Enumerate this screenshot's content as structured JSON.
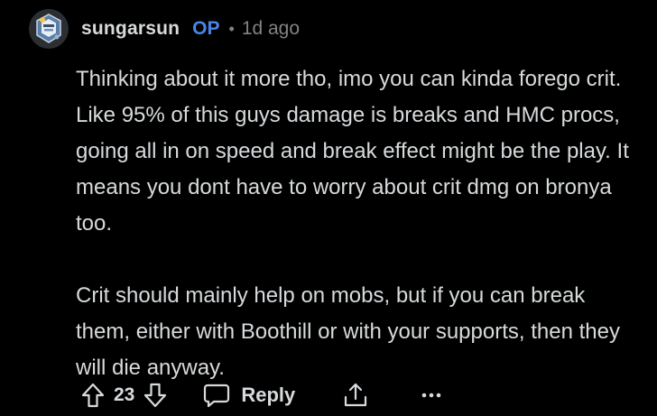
{
  "comment": {
    "author": "sungarsun",
    "op_badge": "OP",
    "separator": "•",
    "timestamp": "1d ago",
    "paragraphs": [
      "Thinking about it more tho, imo you can kinda forego crit. Like 95% of this guys damage is breaks and HMC procs, going all in on speed and break effect might be the play. It means you dont have to worry about crit dmg on bronya too.",
      "Crit should mainly help on mobs, but if you can break them, either with Boothill or with your supports, then they will die anyway."
    ]
  },
  "actions": {
    "upvote_icon": "upvote-arrow-icon",
    "vote_count": "23",
    "downvote_icon": "downvote-arrow-icon",
    "reply_icon": "speech-bubble-icon",
    "reply_label": "Reply",
    "share_icon": "share-icon",
    "more_icon": "more-dots-icon"
  },
  "colors": {
    "background": "#000000",
    "text": "#d7dadc",
    "muted": "#818384",
    "op_accent": "#4a86e8"
  }
}
